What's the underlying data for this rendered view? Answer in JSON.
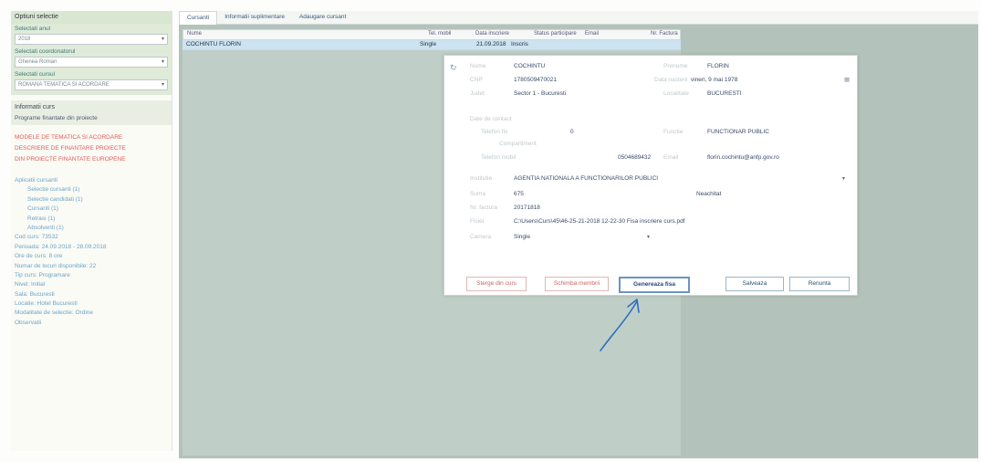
{
  "sidebar": {
    "header": "Optiuni selectie",
    "year_label": "Selectati anul",
    "year_value": "2018",
    "coord_label": "Selectati coordonatorul",
    "coord_value": "Ghenea Roman",
    "group_label": "Selectati cursul",
    "group_value": "ROMANA TEMATICA SI ACORDARE",
    "info_head": "Informatii curs",
    "info_value": "Programe finantate din proiecte",
    "red_items": [
      "MODELE DE TEMATICA SI ACORDARE",
      "DESCRIERE DE FINANTARE PROIECTE",
      "DIN PROIECTE FINANTATE EUROPENE"
    ],
    "blue_items": [
      {
        "text": "Aplicatii cursanti",
        "indent": false
      },
      {
        "text": "Selectie cursanti (1)",
        "indent": true
      },
      {
        "text": "Selectie candidati (1)",
        "indent": true
      },
      {
        "text": "Cursanti (1)",
        "indent": true
      },
      {
        "text": "Retrasi (1)",
        "indent": true
      },
      {
        "text": "Absolventi (1)",
        "indent": true
      },
      {
        "text": "Cod curs: 73532",
        "indent": false
      },
      {
        "text": "Perioada: 24.09.2018 - 28.09.2018",
        "indent": false
      },
      {
        "text": "Ore de curs: 8 ore",
        "indent": false
      },
      {
        "text": "Numar de locuri disponibile: 22",
        "indent": false
      },
      {
        "text": "Tip curs: Programare",
        "indent": false
      },
      {
        "text": "Nivel: Initial",
        "indent": false
      },
      {
        "text": "Sala: Bucuresti",
        "indent": false
      },
      {
        "text": "Locatie: Hotel Bucuresti",
        "indent": false
      },
      {
        "text": "Modalitate de selectie: Ordine",
        "indent": false
      },
      {
        "text": "Observatii",
        "indent": false
      }
    ]
  },
  "tabs": [
    "Cursanti",
    "Informatii suplimentare",
    "Adaugare cursant"
  ],
  "table": {
    "headers": [
      "Nume",
      "Tel. mobil",
      "Data inscriere",
      "Status participare",
      "Email",
      "Nr. Factura"
    ],
    "row": {
      "name": "COCHINTU FLORIN",
      "type": "Single",
      "date": "21.09.2018",
      "status": "Inscris"
    }
  },
  "modal": {
    "lastname_label": "Nume",
    "lastname": "COCHINTU",
    "firstname_label": "Prenume",
    "firstname": "FLORIN",
    "cnp_label": "CNP",
    "cnp": "1780509470021",
    "birthdate_label": "Data nasterii",
    "birthdate": "vineri, 9 mai 1978",
    "sector_label": "Judet",
    "sector": "Sector 1 - Bucuresti",
    "city_label": "Localitate",
    "city": "BUCURESTI",
    "section_label": "Date de contact",
    "phone_label": "Telefon fix",
    "phone": "0",
    "function_label": "Functie",
    "function": "FUNCTIONAR PUBLIC",
    "dept_label": "Compartiment",
    "mobile_label": "Telefon mobil",
    "mobile": "0504689432",
    "email_label": "Email",
    "email": "florin.cochintu@anfp.gov.ro",
    "institution_label": "Institutie",
    "institution": "AGENTIA NATIONALA A FUNCTIONARILOR PUBLICI",
    "fee_label": "Suma",
    "fee": "675",
    "fee_status": "Neachitat",
    "invoice_label": "Nr. factura",
    "invoice": "20171818",
    "file_label": "Fisier",
    "file": "C:\\Users\\Curs\\45\\46-25-21-2018 12-22-30 Fisa inscriere curs.pdf",
    "room_label": "Camera",
    "room": "Single",
    "btn_delete": "Sterge din curs",
    "btn_change": "Schimba membrii",
    "btn_generate": "Genereaza fisa",
    "btn_save": "Salveaza",
    "btn_cancel": "Renunta"
  },
  "colors": {
    "arrow": "#2f6fc0",
    "accent_red": "#e05a5a",
    "accent_blue": "#6aa4c8"
  }
}
